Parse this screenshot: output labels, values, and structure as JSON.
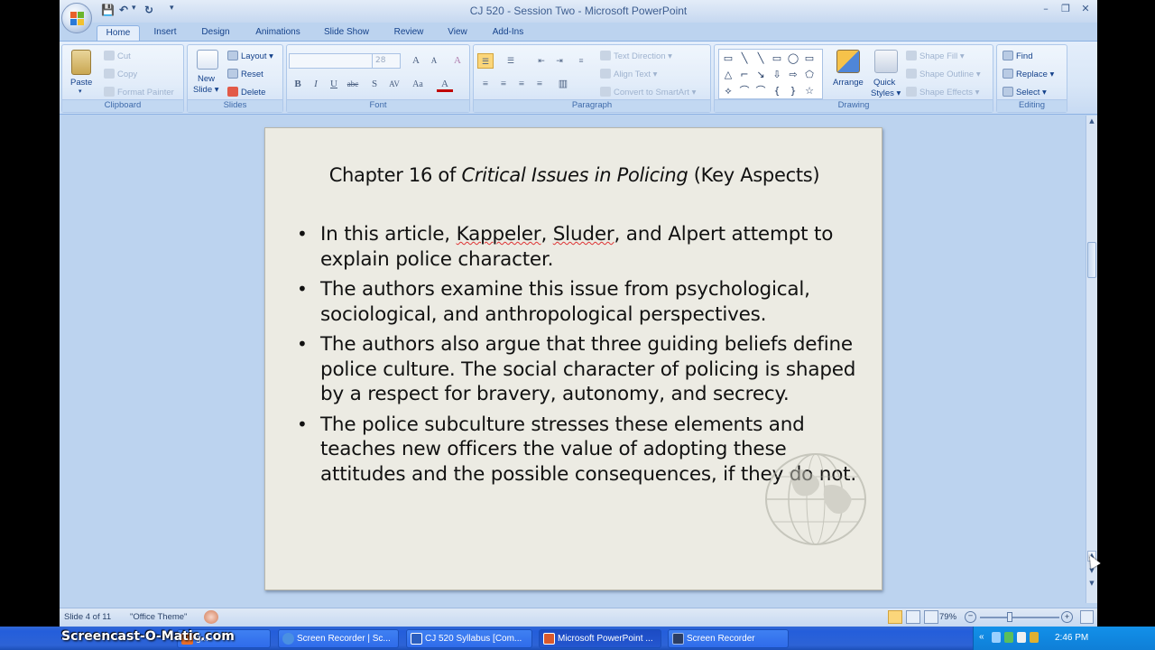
{
  "window": {
    "title": "CJ 520 - Session Two - Microsoft PowerPoint"
  },
  "quick_access": {
    "save": "💾",
    "undo": "↶",
    "undo_dd": "▾",
    "redo": "↻",
    "customize": "▾"
  },
  "window_controls": {
    "minimize": "–",
    "restore": "❐",
    "close": "✕"
  },
  "tabs": [
    {
      "label": "Home",
      "active": true
    },
    {
      "label": "Insert"
    },
    {
      "label": "Design"
    },
    {
      "label": "Animations"
    },
    {
      "label": "Slide Show"
    },
    {
      "label": "Review"
    },
    {
      "label": "View"
    },
    {
      "label": "Add-Ins"
    }
  ],
  "ribbon": {
    "clipboard": {
      "label": "Clipboard",
      "paste": "Paste",
      "paste_dd": "▾",
      "cut": "Cut",
      "copy": "Copy",
      "format_painter": "Format Painter"
    },
    "slides": {
      "label": "Slides",
      "new_slide_1": "New",
      "new_slide_2": "Slide ▾",
      "layout": "Layout ▾",
      "reset": "Reset",
      "delete": "Delete"
    },
    "font": {
      "label": "Font",
      "font_name": "",
      "font_size": "28",
      "grow": "A",
      "shrink": "A",
      "clear": "A",
      "bold": "B",
      "italic": "I",
      "underline": "U",
      "strike": "abc",
      "shadow": "S",
      "spacing": "AV",
      "case": "Aa",
      "color": "A"
    },
    "paragraph": {
      "label": "Paragraph",
      "text_direction": "Text Direction ▾",
      "align_text": "Align Text ▾",
      "smartart": "Convert to SmartArt ▾"
    },
    "drawing": {
      "label": "Drawing",
      "arrange": "Arrange",
      "quick_styles_1": "Quick",
      "quick_styles_2": "Styles ▾",
      "shape_fill": "Shape Fill ▾",
      "shape_outline": "Shape Outline ▾",
      "shape_effects": "Shape Effects ▾",
      "shapes": [
        "▭",
        "╲",
        "╲",
        "▭",
        "◯",
        "▭",
        "△",
        "⌐",
        "↘",
        "⇩",
        "⇨",
        "⬠",
        "⟡",
        "⌒",
        "⌒",
        "{",
        "}",
        "☆"
      ]
    },
    "editing": {
      "label": "Editing",
      "find": "Find",
      "replace": "Replace ▾",
      "select": "Select ▾"
    }
  },
  "slide": {
    "title_pre": "Chapter 16 of ",
    "title_italic": "Critical Issues in Policing",
    "title_post": " (Key Aspects)",
    "bullet_char": "•",
    "bullet1_pre": "In this article, ",
    "bullet1_name1": "Kappeler",
    "bullet1_sep": ", ",
    "bullet1_name2": "Sluder",
    "bullet1_post": ", and Alpert attempt to explain police character.",
    "bullet2": "The authors examine this issue from psychological, sociological, and anthropological perspectives.",
    "bullet3": "The authors also argue that three guiding beliefs define police culture. The social character of policing is shaped by a respect for bravery, autonomy, and secrecy.",
    "bullet4": "The police subculture stresses these elements and teaches new officers the value of adopting these attitudes and the possible consequences, if they do not."
  },
  "statusbar": {
    "slide_info": "Slide 4 of 11",
    "theme": "\"Office Theme\"",
    "zoom": "79%"
  },
  "taskbar": {
    "items": [
      {
        "label": "g..."
      },
      {
        "label": "Screen Recorder | Sc..."
      },
      {
        "label": "CJ 520 Syllabus [Com..."
      },
      {
        "label": "Microsoft PowerPoint ...",
        "active": true
      },
      {
        "label": "Screen Recorder"
      }
    ],
    "clock": "2:46 PM",
    "watermark": "Screencast-O-Matic.com"
  },
  "colors": {
    "accent": "#15428b",
    "ribbon_bg": "#d8e6f7",
    "slide_bg": "#ecebe3",
    "taskbar": "#245edb"
  }
}
